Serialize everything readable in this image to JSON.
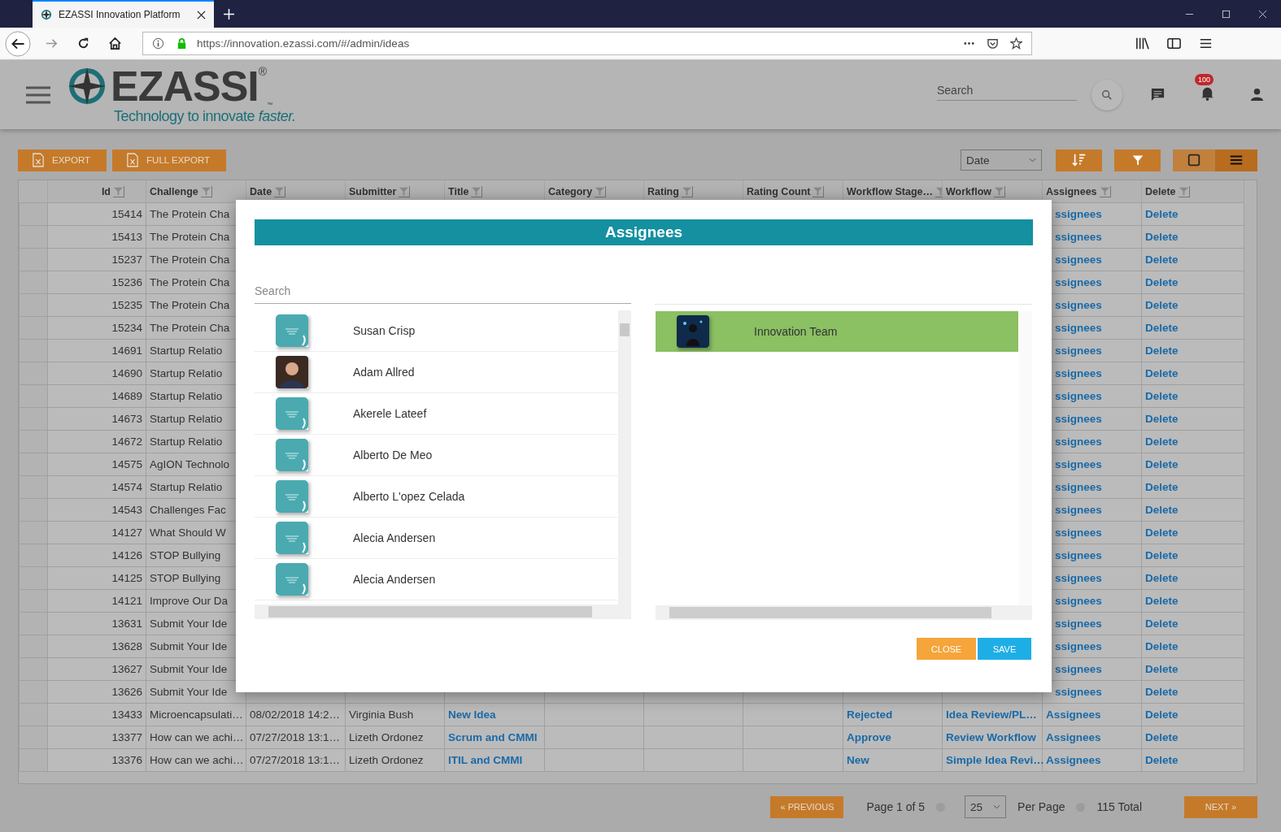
{
  "browser": {
    "tab_title": "EZASSI Innovation Platform",
    "url": "https://innovation.ezassi.com/#/admin/ideas"
  },
  "header": {
    "logo": "EZASSI",
    "logo_registered": "®",
    "logo_trademark": "™",
    "tagline": "Technology to innovate *faster.*",
    "search": {
      "placeholder": "Search"
    },
    "notification_count": "100"
  },
  "toolbar": {
    "buttons": [
      "EXPORT",
      "FULL EXPORT"
    ],
    "sort_select": "Date",
    "views": [
      {
        "kind": "grid",
        "selected": false
      },
      {
        "kind": "list",
        "selected": true
      }
    ]
  },
  "table": {
    "columns": [
      "Id",
      "Challenge",
      "Date",
      "Submitter",
      "Title",
      "Category",
      "Rating",
      "Rating Count",
      "Workflow Stage…",
      "Workflow",
      "Assignees",
      "Delete"
    ],
    "rows": [
      {
        "kind": "covered",
        "id": "15414",
        "challenge": "The Protein Cha",
        "assignees": "ssignees",
        "delete": "Delete"
      },
      {
        "kind": "covered",
        "id": "15413",
        "challenge": "The Protein Cha",
        "assignees": "ssignees",
        "delete": "Delete"
      },
      {
        "kind": "covered",
        "id": "15237",
        "challenge": "The Protein Cha",
        "assignees": "ssignees",
        "delete": "Delete"
      },
      {
        "kind": "covered",
        "id": "15236",
        "challenge": "The Protein Cha",
        "assignees": "ssignees",
        "delete": "Delete"
      },
      {
        "kind": "covered",
        "id": "15235",
        "challenge": "The Protein Cha",
        "assignees": "ssignees",
        "delete": "Delete"
      },
      {
        "kind": "covered",
        "id": "15234",
        "challenge": "The Protein Cha",
        "assignees": "ssignees",
        "delete": "Delete"
      },
      {
        "kind": "covered",
        "id": "14691",
        "challenge": "Startup Relatio",
        "assignees": "ssignees",
        "delete": "Delete"
      },
      {
        "kind": "covered",
        "id": "14690",
        "challenge": "Startup Relatio",
        "assignees": "ssignees",
        "delete": "Delete"
      },
      {
        "kind": "covered",
        "id": "14689",
        "challenge": "Startup Relatio",
        "assignees": "ssignees",
        "delete": "Delete"
      },
      {
        "kind": "covered",
        "id": "14673",
        "challenge": "Startup Relatio",
        "assignees": "ssignees",
        "delete": "Delete"
      },
      {
        "kind": "covered",
        "id": "14672",
        "challenge": "Startup Relatio",
        "assignees": "ssignees",
        "delete": "Delete"
      },
      {
        "kind": "covered",
        "id": "14575",
        "challenge": "AgION Technolo",
        "assignees": "ssignees",
        "delete": "Delete"
      },
      {
        "kind": "covered",
        "id": "14574",
        "challenge": "Startup Relatio",
        "assignees": "ssignees",
        "delete": "Delete"
      },
      {
        "kind": "covered",
        "id": "14543",
        "challenge": "Challenges Fac",
        "assignees": "ssignees",
        "delete": "Delete"
      },
      {
        "kind": "covered",
        "id": "14127",
        "challenge": "What Should W",
        "assignees": "ssignees",
        "delete": "Delete"
      },
      {
        "kind": "covered",
        "id": "14126",
        "challenge": "STOP Bullying",
        "assignees": "ssignees",
        "delete": "Delete"
      },
      {
        "kind": "covered",
        "id": "14125",
        "challenge": "STOP Bullying",
        "assignees": "ssignees",
        "delete": "Delete"
      },
      {
        "kind": "covered",
        "id": "14121",
        "challenge": "Improve Our Da",
        "assignees": "ssignees",
        "delete": "Delete"
      },
      {
        "kind": "covered",
        "id": "13631",
        "challenge": "Submit Your Ide",
        "assignees": "ssignees",
        "delete": "Delete"
      },
      {
        "kind": "covered",
        "id": "13628",
        "challenge": "Submit Your Ide",
        "assignees": "ssignees",
        "delete": "Delete"
      },
      {
        "kind": "covered",
        "id": "13627",
        "challenge": "Submit Your Ide",
        "assignees": "ssignees",
        "delete": "Delete"
      },
      {
        "kind": "covered",
        "id": "13626",
        "challenge": "Submit Your Ide",
        "assignees": "ssignees",
        "delete": "Delete"
      },
      {
        "kind": "full",
        "id": "13433",
        "challenge": "Microencapsulati…",
        "date": "08/02/2018 14:2…",
        "submitter": "Virginia Bush",
        "title": "New Idea",
        "stage": "Rejected",
        "workflow": "Idea Review/PL…",
        "assignees": "Assignees",
        "delete": "Delete"
      },
      {
        "kind": "full",
        "id": "13377",
        "challenge": "How can we achi…",
        "date": "07/27/2018 13:1…",
        "submitter": "Lizeth Ordonez",
        "title": "Scrum and CMMI",
        "stage": "Approve",
        "workflow": "Review Workflow",
        "assignees": "Assignees",
        "delete": "Delete"
      },
      {
        "kind": "full",
        "id": "13376",
        "challenge": "How can we achi…",
        "date": "07/27/2018 13:1…",
        "submitter": "Lizeth Ordonez",
        "title": "ITIL and CMMI",
        "stage": "New",
        "workflow": "Simple Idea Revi…",
        "assignees": "Assignees",
        "delete": "Delete"
      }
    ]
  },
  "pagination": {
    "previous": "« PREVIOUS",
    "page": "Page 1 of 5",
    "per_page": "25",
    "per_page_label": "Per Page",
    "total": "115 Total",
    "next": "NEXT »"
  },
  "modal": {
    "title": "Assignees",
    "search": {
      "placeholder": "Search"
    },
    "available": [
      {
        "name": "Susan Crisp",
        "kind": "default"
      },
      {
        "name": "Adam Allred",
        "kind": "photo"
      },
      {
        "name": "Akerele Lateef",
        "kind": "default"
      },
      {
        "name": "Alberto De Meo",
        "kind": "default"
      },
      {
        "name": "Alberto L'opez Celada",
        "kind": "default"
      },
      {
        "name": "Alecia Andersen",
        "kind": "default"
      },
      {
        "name": "Alecia Andersen",
        "kind": "default"
      }
    ],
    "assigned": [
      {
        "name": "Innovation Team",
        "kind": "team",
        "selected": true
      }
    ],
    "buttons": [
      "CLOSE",
      "SAVE"
    ]
  }
}
